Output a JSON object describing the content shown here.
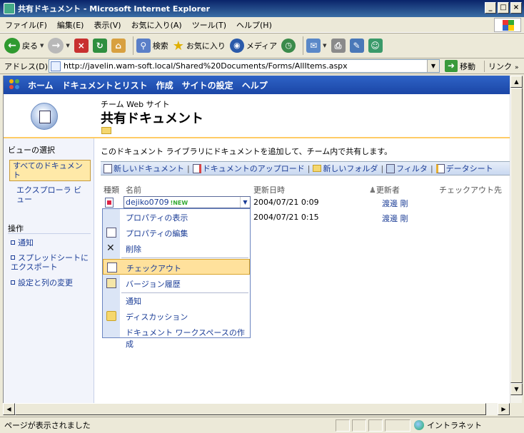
{
  "window": {
    "title": "共有ドキュメント - Microsoft Internet Explorer",
    "buttons": [
      "_",
      "□",
      "×"
    ]
  },
  "menubar": [
    "ファイル(F)",
    "編集(E)",
    "表示(V)",
    "お気に入り(A)",
    "ツール(T)",
    "ヘルプ(H)"
  ],
  "toolbar": {
    "back": "戻る",
    "search": "検索",
    "favorites": "お気に入り",
    "media": "メディア"
  },
  "address": {
    "label": "アドレス(D)",
    "url": "http://javelin.wam-soft.local/Shared%20Documents/Forms/AllItems.aspx",
    "go": "移動",
    "links": "リンク"
  },
  "spnav": {
    "items": [
      "ホーム",
      "ドキュメントとリスト",
      "作成",
      "サイトの設定",
      "ヘルプ"
    ]
  },
  "header": {
    "site_name": "チーム Web サイト",
    "page_title": "共有ドキュメント"
  },
  "leftnav": {
    "view_header": "ビューの選択",
    "selected_view": "すべてのドキュメント",
    "explorer_view": "エクスプローラ ビュー",
    "actions_header": "操作",
    "actions": [
      "通知",
      "スプレッドシートにエクスポート",
      "設定と列の変更"
    ]
  },
  "main": {
    "description": "このドキュメント ライブラリにドキュメントを追加して、チーム内で共有します。",
    "toolbar": [
      "新しいドキュメント",
      "ドキュメントのアップロード",
      "新しいフォルダ",
      "フィルタ",
      "データシート"
    ],
    "columns": {
      "type": "種類",
      "name": "名前",
      "modified": "更新日時",
      "modified_by": "更新者",
      "checked_out": "チェックアウト先"
    },
    "rows": [
      {
        "name": "dejiko0709",
        "new_badge": "NEW",
        "modified": "2004/07/21 0:09",
        "modified_by": "渡邊 剛"
      },
      {
        "modified": "2004/07/21 0:15",
        "modified_by": "渡邊 剛"
      }
    ]
  },
  "context_menu": {
    "items": [
      "プロパティの表示",
      "プロパティの編集",
      "削除",
      "チェックアウト",
      "バージョン履歴",
      "通知",
      "ディスカッション",
      "ドキュメント ワークスペースの作成"
    ],
    "selected": "チェックアウト"
  },
  "statusbar": {
    "text": "ページが表示されました",
    "zone": "イントラネット"
  },
  "colors": {
    "nav_blue": "#1b46a6",
    "highlight": "#ffe19c",
    "link": "#1a3c96",
    "accent_border": "#ffcc66"
  }
}
